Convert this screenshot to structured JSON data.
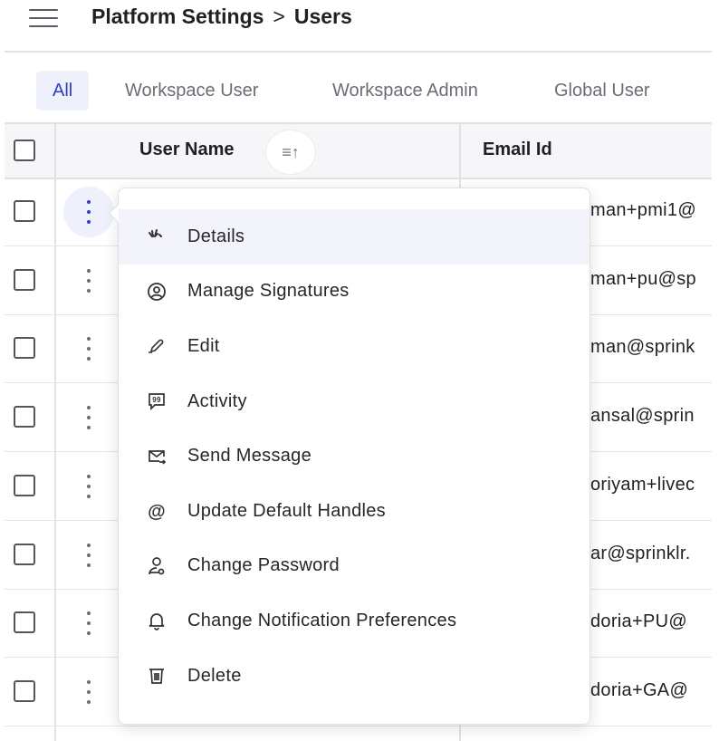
{
  "header": {
    "breadcrumb": [
      "Platform Settings",
      "Users"
    ],
    "separator": ">",
    "menu_icon": "hamburger-icon"
  },
  "tabs": [
    {
      "label": "All",
      "active": true
    },
    {
      "label": "Workspace User"
    },
    {
      "label": "Workspace Admin"
    },
    {
      "label": "Global User"
    }
  ],
  "table": {
    "columns": [
      "User Name",
      "Email Id"
    ],
    "sort_icon": "sort-ascending-icon",
    "rows": [
      {
        "email_visible": "man+pmi1@"
      },
      {
        "email_visible": "man+pu@sp"
      },
      {
        "email_visible": "man@sprink"
      },
      {
        "email_visible": "ansal@sprin"
      },
      {
        "email_visible": "oriyam+livec"
      },
      {
        "email_visible": "ar@sprinklr."
      },
      {
        "email_visible": "doria+PU@"
      },
      {
        "email_visible": "doria+GA@"
      }
    ]
  },
  "context_menu": {
    "items": [
      {
        "label": "Details",
        "icon": "details-icon"
      },
      {
        "label": "Manage Signatures",
        "icon": "user-circle-icon"
      },
      {
        "label": "Edit",
        "icon": "pencil-icon"
      },
      {
        "label": "Activity",
        "icon": "quote-bubble-icon"
      },
      {
        "label": "Send Message",
        "icon": "mail-send-icon"
      },
      {
        "label": "Update Default Handles",
        "icon": "at-icon"
      },
      {
        "label": "Change Password",
        "icon": "user-key-icon"
      },
      {
        "label": "Change Notification Preferences",
        "icon": "bell-icon"
      },
      {
        "label": "Delete",
        "icon": "trash-icon"
      }
    ]
  },
  "colors": {
    "accent": "#2f3fc2",
    "active_bg": "#eef0fb"
  }
}
